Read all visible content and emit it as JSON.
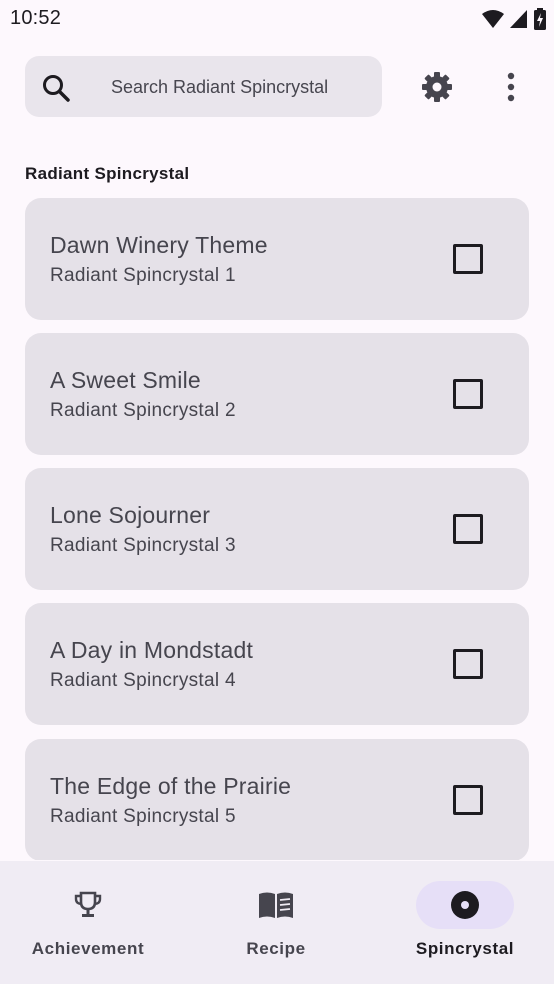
{
  "status_bar": {
    "time": "10:52"
  },
  "search": {
    "placeholder": "Search Radiant Spincrystal",
    "value": ""
  },
  "section": {
    "title": "Radiant Spincrystal"
  },
  "items": [
    {
      "title": "Dawn Winery Theme",
      "subtitle": "Radiant Spincrystal 1",
      "checked": false
    },
    {
      "title": "A Sweet Smile",
      "subtitle": "Radiant Spincrystal 2",
      "checked": false
    },
    {
      "title": "Lone Sojourner",
      "subtitle": "Radiant Spincrystal 3",
      "checked": false
    },
    {
      "title": "A Day in Mondstadt",
      "subtitle": "Radiant Spincrystal 4",
      "checked": false
    },
    {
      "title": "The Edge of the Prairie",
      "subtitle": "Radiant Spincrystal 5",
      "checked": false
    }
  ],
  "nav": {
    "tabs": [
      {
        "label": "Achievement",
        "icon": "trophy-icon",
        "active": false
      },
      {
        "label": "Recipe",
        "icon": "book-icon",
        "active": false
      },
      {
        "label": "Spincrystal",
        "icon": "disc-icon",
        "active": true
      }
    ]
  },
  "colors": {
    "background": "#fdf8fd",
    "card": "#e5e1e8",
    "search_bar": "#e9e5ec",
    "nav_bar": "#f0ecf4",
    "active_pill": "#e6dff7",
    "text": "#1d1b20"
  }
}
